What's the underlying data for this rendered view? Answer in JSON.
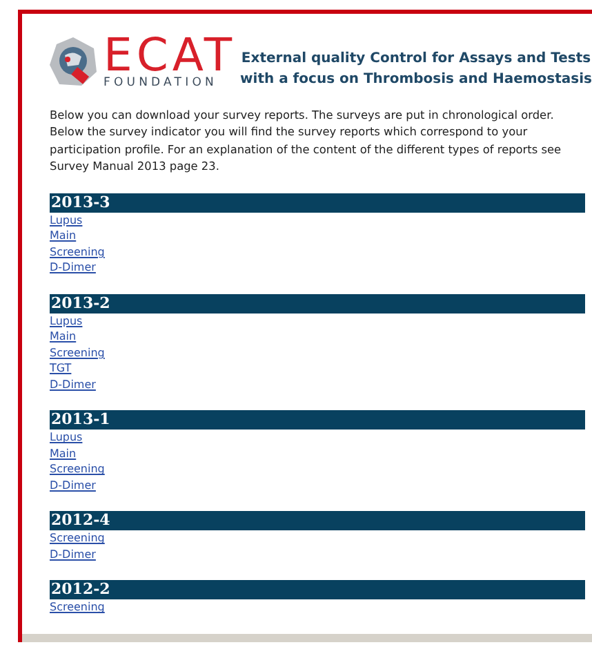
{
  "logo": {
    "name": "ECAT",
    "subtitle": "FOUNDATION"
  },
  "tagline": [
    "External quality Control for Assays and Tests",
    "with a focus on Thrombosis and Haemostasis"
  ],
  "intro": "Below you can download your survey reports. The surveys are put in chronological order. Below the survey indicator you will find the survey reports which correspond to your participation profile. For an explanation of the content of the different types of reports see Survey Manual 2013 page 23.",
  "surveys": [
    {
      "title": "2013-3",
      "reports": [
        "Lupus",
        "Main",
        "Screening",
        "D-Dimer"
      ]
    },
    {
      "title": "2013-2",
      "reports": [
        "Lupus",
        "Main",
        "Screening",
        "TGT",
        "D-Dimer"
      ]
    },
    {
      "title": "2013-1",
      "reports": [
        "Lupus",
        "Main",
        "Screening",
        "D-Dimer"
      ]
    },
    {
      "title": "2012-4",
      "reports": [
        "Screening",
        "D-Dimer"
      ]
    },
    {
      "title": "2012-2",
      "reports": [
        "Screening"
      ]
    }
  ]
}
